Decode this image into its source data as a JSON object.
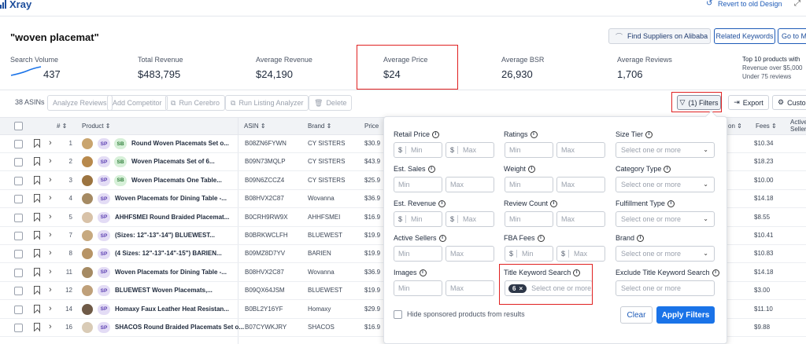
{
  "app": {
    "title": "Xray",
    "revert_label": "Revert to old Design"
  },
  "keyword_title": "\"woven placemat\"",
  "actions": {
    "suppliers": "Find Suppliers on Alibaba",
    "related": "Related Keywords",
    "goto": "Go to M"
  },
  "stats": [
    {
      "label": "Search Volume",
      "value": "437"
    },
    {
      "label": "Total Revenue",
      "value": "$483,795"
    },
    {
      "label": "Average Revenue",
      "value": "$24,190"
    },
    {
      "label": "Average Price",
      "value": "$24"
    },
    {
      "label": "Average BSR",
      "value": "26,930"
    },
    {
      "label": "Average Reviews",
      "value": "1,706"
    }
  ],
  "top10": {
    "line1": "Top 10 products with",
    "line2": "Revenue over $5,000",
    "line3": "Under 75 reviews"
  },
  "toolbar": {
    "asins": "38 ASINs",
    "analyze": "Analyze Reviews",
    "competitor": "Add Competitor",
    "cerebro": "Run Cerebro",
    "listing": "Run Listing Analyzer",
    "delete": "Delete",
    "filters": "(1) Filters",
    "export": "Export",
    "custom": "Custom"
  },
  "columns": {
    "num": "#",
    "product": "Product",
    "asin": "ASIN",
    "brand": "Brand",
    "price": "Price",
    "on": "on",
    "fees": "Fees",
    "active": "Active",
    "sellers": "Sellers"
  },
  "rows": [
    {
      "num": "1",
      "sb": true,
      "title": "Round Woven Placemats Set o...",
      "asin": "B08ZN6FYWN",
      "brand": "CY SISTERS",
      "price": "$30.9",
      "fees": "$10.34",
      "thumb": "#c9a46e"
    },
    {
      "num": "2",
      "sb": true,
      "title": "Woven Placemats Set of 6...",
      "asin": "B09N73MQLP",
      "brand": "CY SISTERS",
      "price": "$43.9",
      "fees": "$18.23",
      "thumb": "#b8894c"
    },
    {
      "num": "3",
      "sb": true,
      "title": "Woven Placemats One Table...",
      "asin": "B09N6ZCCZ4",
      "brand": "CY SISTERS",
      "price": "$25.9",
      "fees": "$10.00",
      "thumb": "#9c7440"
    },
    {
      "num": "4",
      "sb": false,
      "title": "Woven Placemats for Dining Table -...",
      "asin": "B08HVX2C87",
      "brand": "Wovanna",
      "price": "$36.9",
      "fees": "$14.18",
      "thumb": "#a58a63"
    },
    {
      "num": "5",
      "sb": false,
      "title": "AHHFSMEI Round Braided Placemat...",
      "asin": "B0CRH9RW9X",
      "brand": "AHHFSMEI",
      "price": "$16.9",
      "fees": "$8.55",
      "thumb": "#d8c2a8"
    },
    {
      "num": "7",
      "sb": false,
      "title": "(Sizes: 12\"-13\"-14\") BLUEWEST...",
      "asin": "B0BRKWCLFH",
      "brand": "BLUEWEST",
      "price": "$19.9",
      "fees": "$10.41",
      "thumb": "#c7a97f"
    },
    {
      "num": "8",
      "sb": false,
      "title": "(4 Sizes: 12\"-13\"-14\"-15\") BARIEN...",
      "asin": "B09MZ8D7YV",
      "brand": "BARIEN",
      "price": "$19.9",
      "fees": "$10.83",
      "thumb": "#b79466"
    },
    {
      "num": "11",
      "sb": false,
      "title": "Woven Placemats for Dining Table -...",
      "asin": "B08HVX2C87",
      "brand": "Wovanna",
      "price": "$36.9",
      "fees": "$14.18",
      "thumb": "#a58a63"
    },
    {
      "num": "12",
      "sb": false,
      "title": "BLUEWEST Woven Placemats,...",
      "asin": "B09QX64JSM",
      "brand": "BLUEWEST",
      "price": "$19.9",
      "fees": "$3.00",
      "thumb": "#bfa07a"
    },
    {
      "num": "14",
      "sb": false,
      "title": "Homaxy Faux Leather Heat Resistan...",
      "asin": "B0BL2Y16YF",
      "brand": "Homaxy",
      "price": "$29.9",
      "fees": "$11.10",
      "thumb": "#6f5a47"
    },
    {
      "num": "16",
      "sb": false,
      "title": "SHACOS Round Braided Placemats Set o...",
      "asin": "B07CYWKJRY",
      "brand": "SHACOS",
      "price": "$16.9",
      "fees": "$9.88",
      "thumb": "#d9cbb6"
    }
  ],
  "filters": {
    "retail_price": "Retail Price",
    "ratings": "Ratings",
    "size_tier": "Size Tier",
    "est_sales": "Est. Sales",
    "weight": "Weight",
    "category_type": "Category Type",
    "est_revenue": "Est. Revenue",
    "review_count": "Review Count",
    "fulfillment_type": "Fulfillment Type",
    "active_sellers": "Active Sellers",
    "fba_fees": "FBA Fees",
    "brand": "Brand",
    "images": "Images",
    "title_kw": "Title Keyword Search",
    "excl_title_kw": "Exclude Title Keyword Search",
    "min": "Min",
    "max": "Max",
    "select": "Select one or more",
    "chip_count": "6",
    "currency": "$",
    "hide_sponsored": "Hide sponsored products from results",
    "clear": "Clear",
    "apply": "Apply Filters"
  },
  "colors": {
    "accent": "#1a73e8",
    "highlight": "#e02020"
  }
}
